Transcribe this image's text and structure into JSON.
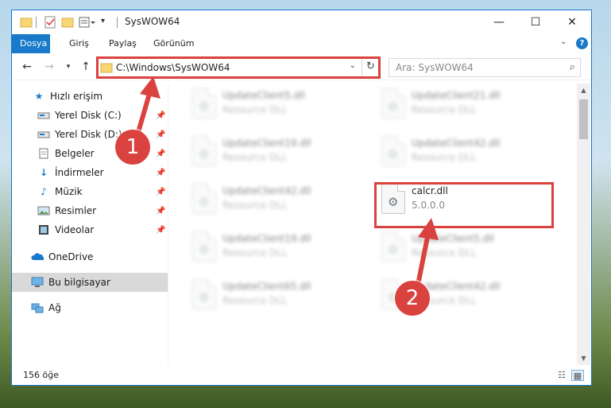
{
  "window": {
    "title": "SysWOW64"
  },
  "title_controls": [
    "minimize",
    "maximize",
    "close"
  ],
  "ribbon": {
    "tabs": [
      {
        "label": "Dosya",
        "active": true
      },
      {
        "label": "Giriş",
        "active": false
      },
      {
        "label": "Paylaş",
        "active": false
      },
      {
        "label": "Görünüm",
        "active": false
      }
    ],
    "help": "?"
  },
  "navigation": {
    "address": "C:\\Windows\\SysWOW64",
    "search_placeholder": "Ara: SysWOW64"
  },
  "sidebar": {
    "items": [
      {
        "label": "Hızlı erişim",
        "icon": "star-icon",
        "pinned": false
      },
      {
        "label": "Yerel Disk (C:)",
        "icon": "drive-icon",
        "pinned": true
      },
      {
        "label": "Yerel Disk (D:)",
        "icon": "drive-icon",
        "pinned": true
      },
      {
        "label": "Belgeler",
        "icon": "documents-icon",
        "pinned": true
      },
      {
        "label": "İndirmeler",
        "icon": "download-icon",
        "pinned": true
      },
      {
        "label": "Müzik",
        "icon": "music-icon",
        "pinned": true
      },
      {
        "label": "Resimler",
        "icon": "pictures-icon",
        "pinned": true
      },
      {
        "label": "Videolar",
        "icon": "videos-icon",
        "pinned": true
      },
      {
        "label": "OneDrive",
        "icon": "cloud-icon",
        "pinned": false
      },
      {
        "label": "Bu bilgisayar",
        "icon": "computer-icon",
        "pinned": false,
        "selected": true
      },
      {
        "label": "Ağ",
        "icon": "network-icon",
        "pinned": false
      }
    ]
  },
  "files": [
    {
      "name": "UpdateClient5.dll",
      "desc": "Resource DLL",
      "blurred": true
    },
    {
      "name": "UpdateClient21.dll",
      "desc": "Resource DLL",
      "blurred": true
    },
    {
      "name": "UpdateClient19.dll",
      "desc": "Resource DLL",
      "blurred": true
    },
    {
      "name": "UpdateClient42.dll",
      "desc": "Resource DLL",
      "blurred": true
    },
    {
      "name": "UpdateClient42.dll",
      "desc": "Resource DLL",
      "blurred": true
    },
    {
      "name": "calcr.dll",
      "desc": "5.0.0.0",
      "blurred": false
    },
    {
      "name": "UpdateClient19.dll",
      "desc": "Resource DLL",
      "blurred": true
    },
    {
      "name": "UpdateClient5.dll",
      "desc": "Resource DLL",
      "blurred": true
    },
    {
      "name": "UpdateClient65.dll",
      "desc": "Resource DLL",
      "blurred": true
    },
    {
      "name": "UpdateClient42.dll",
      "desc": "Resource DLL",
      "blurred": true
    }
  ],
  "status": {
    "item_count": "156 öğe"
  },
  "annotations": {
    "step1": "1",
    "step2": "2",
    "color": "#d9423f"
  },
  "colors": {
    "accent": "#1979ca",
    "highlight": "#d9423f"
  }
}
